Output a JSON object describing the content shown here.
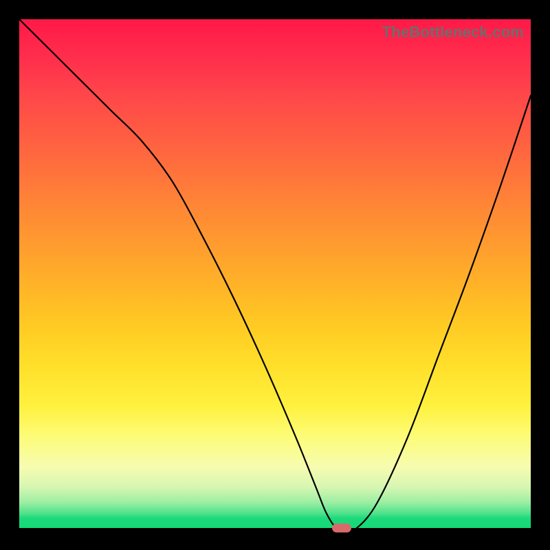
{
  "watermark": "TheBottleneck.com",
  "chart_data": {
    "type": "line",
    "title": "",
    "xlabel": "",
    "ylabel": "",
    "xlim": [
      0,
      100
    ],
    "ylim": [
      0,
      100
    ],
    "series": [
      {
        "name": "bottleneck-curve",
        "x": [
          0,
          6,
          12,
          18,
          24,
          30,
          36,
          42,
          48,
          54,
          58,
          60,
          62,
          64,
          66,
          70,
          76,
          82,
          88,
          94,
          100
        ],
        "values": [
          100,
          94,
          88,
          82,
          76,
          68,
          57,
          45,
          32,
          18,
          8,
          3,
          0,
          0,
          0,
          5,
          18,
          34,
          50,
          67,
          85
        ]
      }
    ],
    "annotations": [
      {
        "name": "optimal-marker",
        "x": 63,
        "y": 0
      }
    ],
    "background_gradient": {
      "orientation": "vertical",
      "stops": [
        {
          "pos": 0.0,
          "color": "#ff1947"
        },
        {
          "pos": 0.5,
          "color": "#ffb228"
        },
        {
          "pos": 0.8,
          "color": "#fdfc78"
        },
        {
          "pos": 1.0,
          "color": "#15d977"
        }
      ]
    }
  }
}
